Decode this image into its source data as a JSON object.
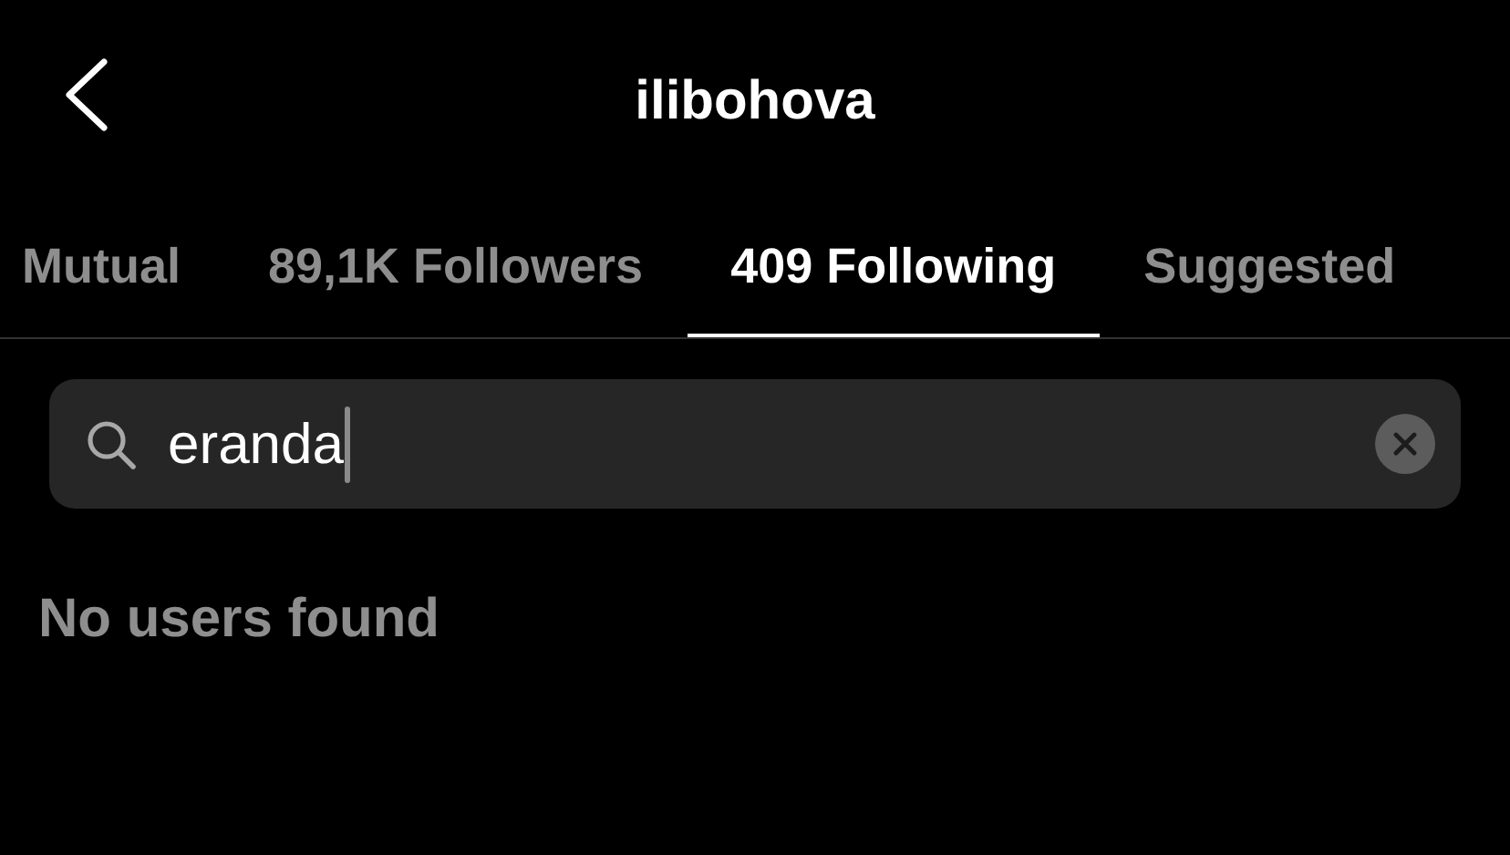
{
  "header": {
    "title": "ilibohova"
  },
  "tabs": [
    {
      "label": "Mutual",
      "selected": false
    },
    {
      "label": "89,1K Followers",
      "selected": false
    },
    {
      "label": "409 Following",
      "selected": true
    },
    {
      "label": "Suggested",
      "selected": false
    }
  ],
  "search": {
    "value": "eranda"
  },
  "empty_message": "No users found"
}
